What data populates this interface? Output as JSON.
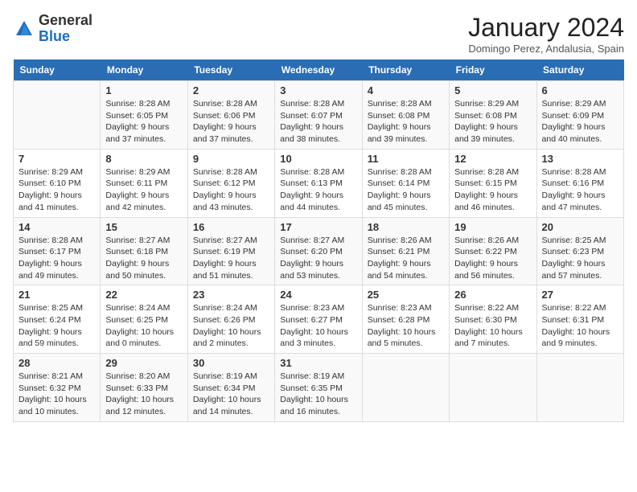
{
  "logo": {
    "general": "General",
    "blue": "Blue"
  },
  "title": "January 2024",
  "subtitle": "Domingo Perez, Andalusia, Spain",
  "days_of_week": [
    "Sunday",
    "Monday",
    "Tuesday",
    "Wednesday",
    "Thursday",
    "Friday",
    "Saturday"
  ],
  "weeks": [
    [
      {
        "day": "",
        "info": ""
      },
      {
        "day": "1",
        "info": "Sunrise: 8:28 AM\nSunset: 6:05 PM\nDaylight: 9 hours\nand 37 minutes."
      },
      {
        "day": "2",
        "info": "Sunrise: 8:28 AM\nSunset: 6:06 PM\nDaylight: 9 hours\nand 37 minutes."
      },
      {
        "day": "3",
        "info": "Sunrise: 8:28 AM\nSunset: 6:07 PM\nDaylight: 9 hours\nand 38 minutes."
      },
      {
        "day": "4",
        "info": "Sunrise: 8:28 AM\nSunset: 6:08 PM\nDaylight: 9 hours\nand 39 minutes."
      },
      {
        "day": "5",
        "info": "Sunrise: 8:29 AM\nSunset: 6:08 PM\nDaylight: 9 hours\nand 39 minutes."
      },
      {
        "day": "6",
        "info": "Sunrise: 8:29 AM\nSunset: 6:09 PM\nDaylight: 9 hours\nand 40 minutes."
      }
    ],
    [
      {
        "day": "7",
        "info": "Sunrise: 8:29 AM\nSunset: 6:10 PM\nDaylight: 9 hours\nand 41 minutes."
      },
      {
        "day": "8",
        "info": "Sunrise: 8:29 AM\nSunset: 6:11 PM\nDaylight: 9 hours\nand 42 minutes."
      },
      {
        "day": "9",
        "info": "Sunrise: 8:28 AM\nSunset: 6:12 PM\nDaylight: 9 hours\nand 43 minutes."
      },
      {
        "day": "10",
        "info": "Sunrise: 8:28 AM\nSunset: 6:13 PM\nDaylight: 9 hours\nand 44 minutes."
      },
      {
        "day": "11",
        "info": "Sunrise: 8:28 AM\nSunset: 6:14 PM\nDaylight: 9 hours\nand 45 minutes."
      },
      {
        "day": "12",
        "info": "Sunrise: 8:28 AM\nSunset: 6:15 PM\nDaylight: 9 hours\nand 46 minutes."
      },
      {
        "day": "13",
        "info": "Sunrise: 8:28 AM\nSunset: 6:16 PM\nDaylight: 9 hours\nand 47 minutes."
      }
    ],
    [
      {
        "day": "14",
        "info": "Sunrise: 8:28 AM\nSunset: 6:17 PM\nDaylight: 9 hours\nand 49 minutes."
      },
      {
        "day": "15",
        "info": "Sunrise: 8:27 AM\nSunset: 6:18 PM\nDaylight: 9 hours\nand 50 minutes."
      },
      {
        "day": "16",
        "info": "Sunrise: 8:27 AM\nSunset: 6:19 PM\nDaylight: 9 hours\nand 51 minutes."
      },
      {
        "day": "17",
        "info": "Sunrise: 8:27 AM\nSunset: 6:20 PM\nDaylight: 9 hours\nand 53 minutes."
      },
      {
        "day": "18",
        "info": "Sunrise: 8:26 AM\nSunset: 6:21 PM\nDaylight: 9 hours\nand 54 minutes."
      },
      {
        "day": "19",
        "info": "Sunrise: 8:26 AM\nSunset: 6:22 PM\nDaylight: 9 hours\nand 56 minutes."
      },
      {
        "day": "20",
        "info": "Sunrise: 8:25 AM\nSunset: 6:23 PM\nDaylight: 9 hours\nand 57 minutes."
      }
    ],
    [
      {
        "day": "21",
        "info": "Sunrise: 8:25 AM\nSunset: 6:24 PM\nDaylight: 9 hours\nand 59 minutes."
      },
      {
        "day": "22",
        "info": "Sunrise: 8:24 AM\nSunset: 6:25 PM\nDaylight: 10 hours\nand 0 minutes."
      },
      {
        "day": "23",
        "info": "Sunrise: 8:24 AM\nSunset: 6:26 PM\nDaylight: 10 hours\nand 2 minutes."
      },
      {
        "day": "24",
        "info": "Sunrise: 8:23 AM\nSunset: 6:27 PM\nDaylight: 10 hours\nand 3 minutes."
      },
      {
        "day": "25",
        "info": "Sunrise: 8:23 AM\nSunset: 6:28 PM\nDaylight: 10 hours\nand 5 minutes."
      },
      {
        "day": "26",
        "info": "Sunrise: 8:22 AM\nSunset: 6:30 PM\nDaylight: 10 hours\nand 7 minutes."
      },
      {
        "day": "27",
        "info": "Sunrise: 8:22 AM\nSunset: 6:31 PM\nDaylight: 10 hours\nand 9 minutes."
      }
    ],
    [
      {
        "day": "28",
        "info": "Sunrise: 8:21 AM\nSunset: 6:32 PM\nDaylight: 10 hours\nand 10 minutes."
      },
      {
        "day": "29",
        "info": "Sunrise: 8:20 AM\nSunset: 6:33 PM\nDaylight: 10 hours\nand 12 minutes."
      },
      {
        "day": "30",
        "info": "Sunrise: 8:19 AM\nSunset: 6:34 PM\nDaylight: 10 hours\nand 14 minutes."
      },
      {
        "day": "31",
        "info": "Sunrise: 8:19 AM\nSunset: 6:35 PM\nDaylight: 10 hours\nand 16 minutes."
      },
      {
        "day": "",
        "info": ""
      },
      {
        "day": "",
        "info": ""
      },
      {
        "day": "",
        "info": ""
      }
    ]
  ]
}
